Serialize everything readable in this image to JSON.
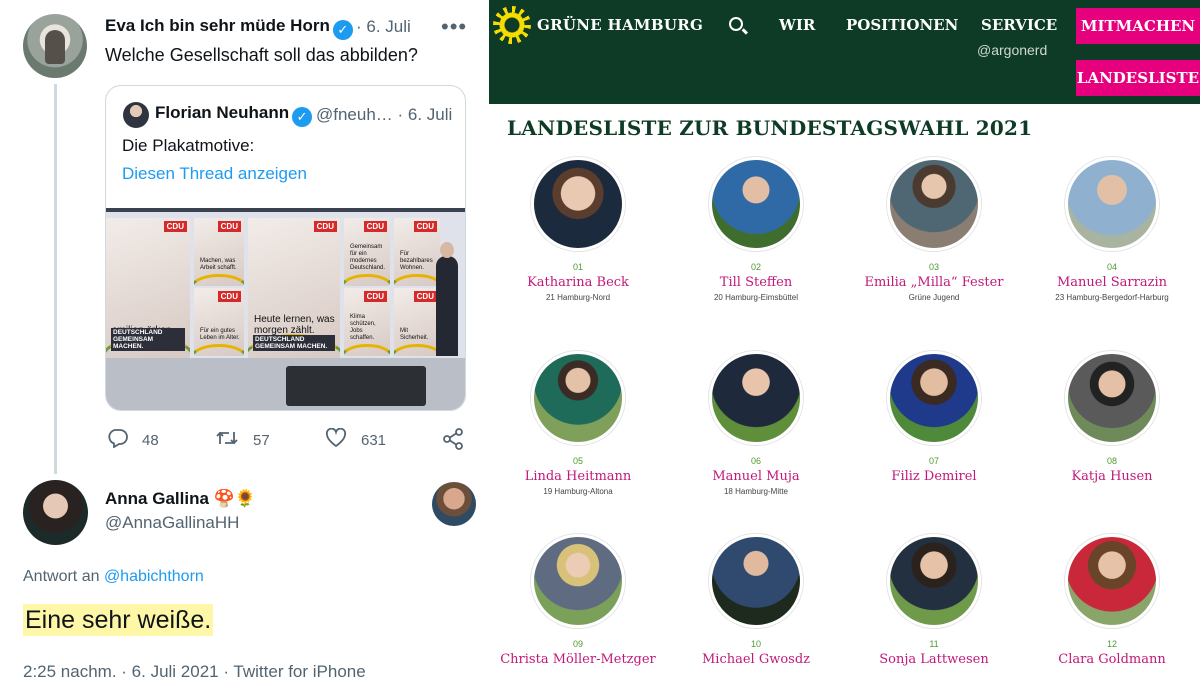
{
  "tweet": {
    "author": "Eva Ich bin sehr müde Horn",
    "date": "· 6. Juli",
    "more": "•••",
    "text": "Welche Gesellschaft soll das abbilden?",
    "verified_glyph": "✓"
  },
  "quote": {
    "author": "Florian Neuhann",
    "handle_date": "@fneuh… · 6. Juli",
    "text": "Die Plakatmotive:",
    "link": "Diesen Thread anzeigen",
    "posters": [
      {
        "label": "amilien ärken.",
        "tag": "DEUTSCHLAND GEMEINSAM MACHEN.",
        "cdu": "CDU"
      },
      {
        "label": "Machen, was Arbeit schafft.",
        "tag": "",
        "cdu": "CDU"
      },
      {
        "label": "Für ein gutes Leben im Alter.",
        "tag": "",
        "cdu": "CDU"
      },
      {
        "label": "Heute lernen, was morgen zählt.",
        "tag": "DEUTSCHLAND GEMEINSAM MACHEN.",
        "cdu": "CDU"
      },
      {
        "label": "Gemeinsam für ein modernes Deutschland.",
        "tag": "",
        "cdu": "CDU"
      },
      {
        "label": "Klima schützen, Jobs schaffen.",
        "tag": "",
        "cdu": "CDU"
      },
      {
        "label": "Für bezahlbares Wohnen.",
        "tag": "",
        "cdu": "CDU"
      },
      {
        "label": "Mit Sicherheit.",
        "tag": "",
        "cdu": "CDU"
      }
    ]
  },
  "actions": {
    "reply": "48",
    "retweet": "57",
    "like": "631",
    "icons": {
      "reply": "reply-icon",
      "retweet": "retweet-icon",
      "like": "heart-icon",
      "share": "share-icon"
    }
  },
  "reply": {
    "author": "Anna Gallina 🍄🌻",
    "handle": "@AnnaGallinaHH",
    "reply_to_prefix": "Antwort an ",
    "reply_to": "@habichthorn",
    "text": "Eine sehr weiße.",
    "footer": "2:25 nachm. · 6. Juli 2021 · Twitter for iPhone"
  },
  "gruene": {
    "brand": "GRÜNE HAMBURG",
    "nav": [
      "WIR",
      "POSITIONEN",
      "SERVICE"
    ],
    "handle": "@argonerd",
    "btn_mitmachen": "MITMACHEN",
    "btn_landesliste": "LANDESLISTE",
    "title": "LANDESLISTE ZUR BUNDESTAGSWAHL 2021",
    "accent_green": "#0e3b26",
    "accent_pink": "#e6007e",
    "candidates": [
      {
        "num": "01",
        "name": "Katharina Beck",
        "wk": "21 Hamburg-Nord"
      },
      {
        "num": "02",
        "name": "Till Steffen",
        "wk": "20 Hamburg-Eimsbüttel"
      },
      {
        "num": "03",
        "name": "Emilia „Milla“ Fester",
        "wk": "Grüne Jugend"
      },
      {
        "num": "04",
        "name": "Manuel Sarrazin",
        "wk": "23 Hamburg-Bergedorf-Harburg"
      },
      {
        "num": "05",
        "name": "Linda Heitmann",
        "wk": "19 Hamburg-Altona"
      },
      {
        "num": "06",
        "name": "Manuel Muja",
        "wk": "18 Hamburg-Mitte"
      },
      {
        "num": "07",
        "name": "Filiz Demirel",
        "wk": ""
      },
      {
        "num": "08",
        "name": "Katja Husen",
        "wk": ""
      },
      {
        "num": "09",
        "name": "Christa Möller-Metzger",
        "wk": ""
      },
      {
        "num": "10",
        "name": "Michael Gwosdz",
        "wk": ""
      },
      {
        "num": "11",
        "name": "Sonja Lattwesen",
        "wk": ""
      },
      {
        "num": "12",
        "name": "Clara Goldmann",
        "wk": ""
      }
    ]
  }
}
